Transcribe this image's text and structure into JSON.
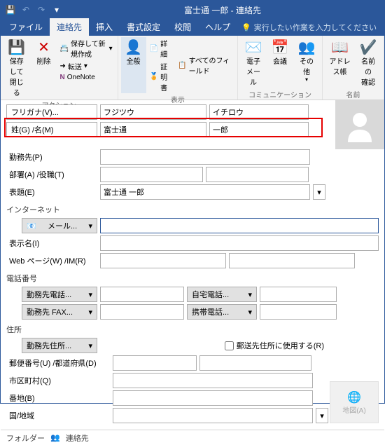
{
  "titlebar": {
    "title": "富士通 一郎 - 連絡先"
  },
  "tabs": {
    "file": "ファイル",
    "contact": "連絡先",
    "insert": "挿入",
    "format": "書式設定",
    "review": "校閲",
    "help": "ヘルプ",
    "tellme": "実行したい作業を入力してください"
  },
  "ribbon": {
    "save_close": "保存して\n閉じる",
    "delete": "削除",
    "save_new": "保存して新規作成",
    "forward": "転送",
    "onenote": "OneNote",
    "group_actions": "アクション",
    "general": "全般",
    "details": "詳細",
    "certificate": "証明書",
    "all_fields": "すべてのフィールド",
    "group_show": "表示",
    "email": "電子\nメール",
    "meeting": "会議",
    "other": "その他",
    "group_comm": "コミュニケーション",
    "address_book": "アドレス帳",
    "check_names": "名前の\n確認",
    "group_names": "名前"
  },
  "form": {
    "furigana_btn": "フリガナ(V)...",
    "furigana_sei": "フジツウ",
    "furigana_mei": "イチロウ",
    "name_btn": "姓(G)  /名(M)",
    "sei": "富士通",
    "mei": "一郎",
    "company": "勤務先(P)",
    "dept": "部署(A)  /役職(T)",
    "display": "表題(E)",
    "display_val": "富士通 一郎",
    "internet_hdr": "インターネット",
    "email_dd": "メール...",
    "display_name": "表示名(I)",
    "web": "Web ページ(W)  /IM(R)",
    "phone_hdr": "電話番号",
    "work_phone": "勤務先電話...",
    "home_phone": "自宅電話...",
    "work_fax": "勤務先 FAX...",
    "mobile": "携帯電話...",
    "address_hdr": "住所",
    "work_addr": "勤務先住所...",
    "mail_chk": "郵送先住所に使用する(R)",
    "postal": "郵便番号(U)  /都道府県(D)",
    "city": "市区町村(Q)",
    "street": "番地(B)",
    "country": "国/地域",
    "map": "地図(A)"
  },
  "footer": {
    "folder": "フォルダー",
    "contacts": "連絡先"
  }
}
